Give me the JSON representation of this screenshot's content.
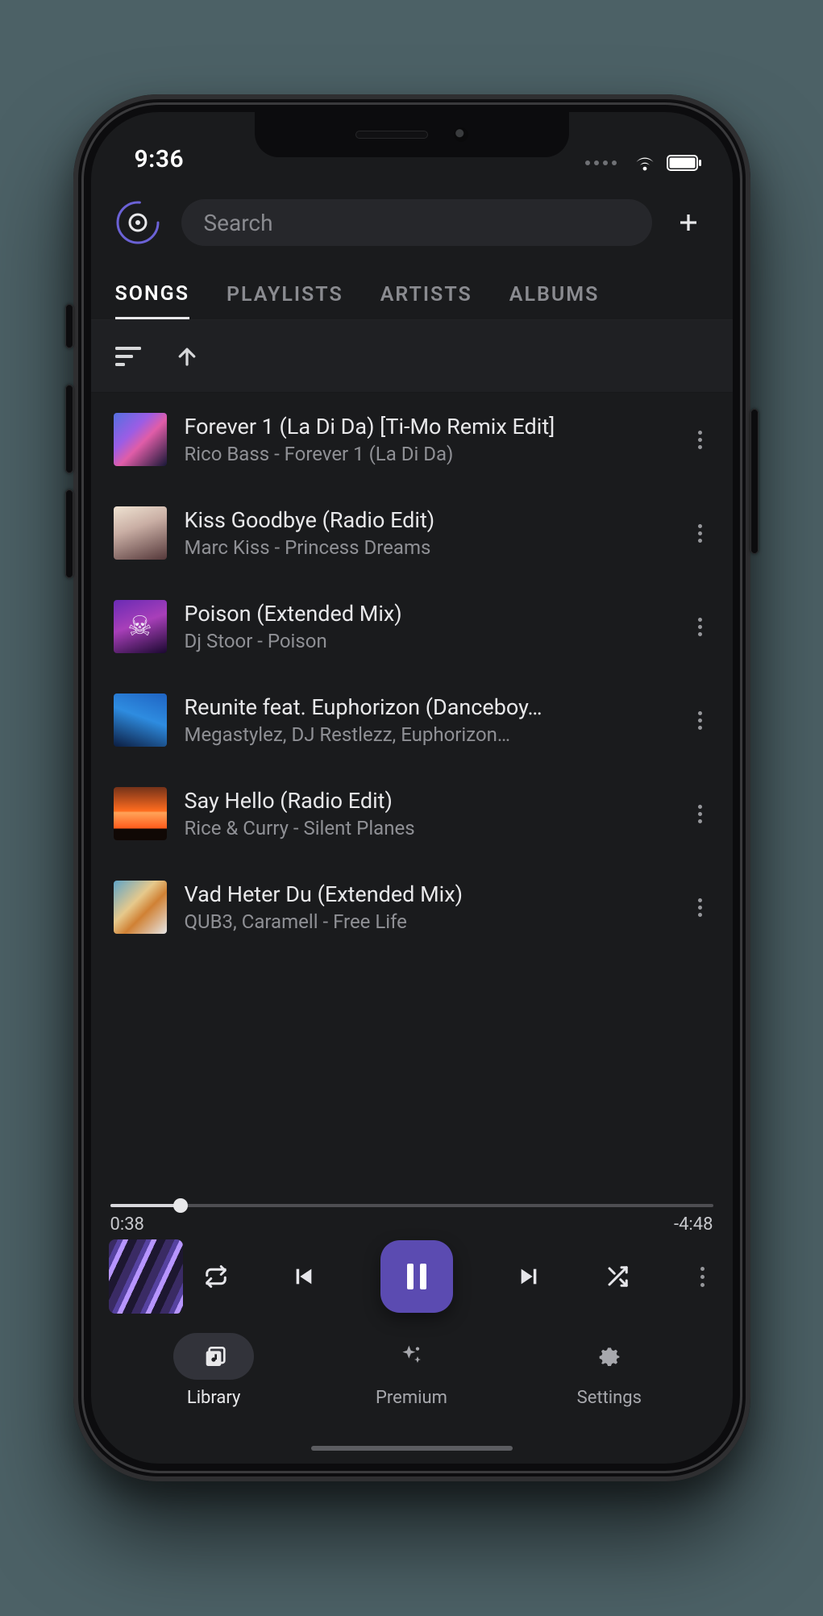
{
  "status": {
    "time": "9:36"
  },
  "search": {
    "placeholder": "Search"
  },
  "tabs": [
    {
      "id": "songs",
      "label": "SONGS",
      "active": true
    },
    {
      "id": "playlists",
      "label": "PLAYLISTS",
      "active": false
    },
    {
      "id": "artists",
      "label": "ARTISTS",
      "active": false
    },
    {
      "id": "albums",
      "label": "ALBUMS",
      "active": false
    }
  ],
  "songs": [
    {
      "title": "Forever 1 (La Di Da) [Ti-Mo Remix Edit]",
      "subtitle": "Rico Bass - Forever 1 (La Di Da)"
    },
    {
      "title": "Kiss Goodbye (Radio Edit)",
      "subtitle": "Marc Kiss - Princess Dreams"
    },
    {
      "title": "Poison (Extended Mix)",
      "subtitle": "Dj Stoor - Poison"
    },
    {
      "title": "Reunite feat. Euphorizon (Danceboy…",
      "subtitle": "Megastylez, DJ Restlezz, Euphorizon…"
    },
    {
      "title": "Say Hello (Radio Edit)",
      "subtitle": "Rice & Curry - Silent Planes"
    },
    {
      "title": "Vad Heter Du (Extended Mix)",
      "subtitle": "QUB3, Caramell - Free Life"
    }
  ],
  "player": {
    "elapsed": "0:38",
    "remaining": "-4:48",
    "progress_pct": 11.7
  },
  "nav": {
    "library": "Library",
    "premium": "Premium",
    "settings": "Settings"
  },
  "colors": {
    "accent": "#5b4bb1",
    "background": "#1a1b1d"
  }
}
